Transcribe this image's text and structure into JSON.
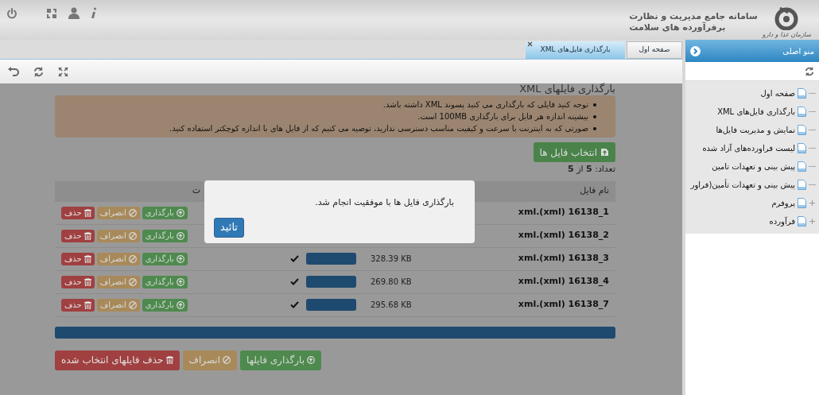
{
  "header": {
    "title": "سامانه جامع مدیریت و نظارت",
    "subtitle": "برفرآورده های سلامت",
    "logo_text": "سازمان غذا و دارو"
  },
  "tabs": [
    {
      "label": "صفحه اول",
      "selected": false,
      "closable": false
    },
    {
      "label": "بارگذاری فایل‌های XML",
      "selected": true,
      "closable": true
    }
  ],
  "sidebar": {
    "title": "منو اصلی",
    "items": [
      {
        "label": "صفحه اول",
        "kind": "leaf"
      },
      {
        "label": "بارگذاری فایل‌های XML",
        "kind": "leaf"
      },
      {
        "label": "نمایش و مدیریت فایل‌ها",
        "kind": "leaf"
      },
      {
        "label": "لیست فراورده‌های آزاد شده",
        "kind": "leaf"
      },
      {
        "label": "پیش بینی و تعهدات تامین",
        "kind": "leaf"
      },
      {
        "label": "پیش بینی و تعهدات تأمین(فراور",
        "kind": "leaf"
      },
      {
        "label": "پروفرم",
        "kind": "folder"
      },
      {
        "label": "فرآورده",
        "kind": "folder"
      }
    ]
  },
  "page": {
    "title": "بارگذاری فایلهای XML",
    "notes": [
      "توجه کنید فایلی که بارگذاری می کنید پسوند XML داشته باشد.",
      "بیشینه اندازه هر فایل برای بارگذاری 100MB است.",
      "صورتی که به اینترنت با سرعت و کیفیت مناسب دسترسی ندارید، توصیه می کنیم که از فایل های با اندازه کوچکتر استفاده کنید."
    ],
    "select_button": "انتخاب فایل ها",
    "count": "تعداد: **5** از **5**",
    "table": {
      "columns": [
        "نام فایل",
        "ت"
      ],
      "rows": [
        {
          "name": "xml.(xml) 16138_1",
          "actions": [
            "بارگذاری",
            "انصراف",
            "حذف"
          ]
        },
        {
          "name": "xml.(xml) 16138_2",
          "actions": [
            "بارگذاری",
            "انصراف",
            "حذف"
          ]
        },
        {
          "name": "xml.(xml) 16138_3",
          "size": "328.39 KB",
          "level": 1,
          "done": true,
          "actions": [
            "بارگذاری",
            "انصراف",
            "حذف"
          ]
        },
        {
          "name": "xml.(xml) 16138_4",
          "size": "269.80 KB",
          "level": 1,
          "done": true,
          "actions": [
            "بارگذاری",
            "انصراف",
            "حذف"
          ]
        },
        {
          "name": "xml.(xml) 16138_7",
          "size": "295.68 KB",
          "level": 1,
          "done": true,
          "actions": [
            "بارگذاری",
            "انصراف",
            "حذف"
          ]
        }
      ]
    },
    "total": {
      "level": 1
    },
    "buttons": [
      "بارگذاری فایلها",
      "انصراف",
      "حذف فایلهای انتخاب شده"
    ]
  },
  "dialog": {
    "message": "بارگذاری فایل ها با موفقیت انجام شد.",
    "button": "تائید"
  }
}
